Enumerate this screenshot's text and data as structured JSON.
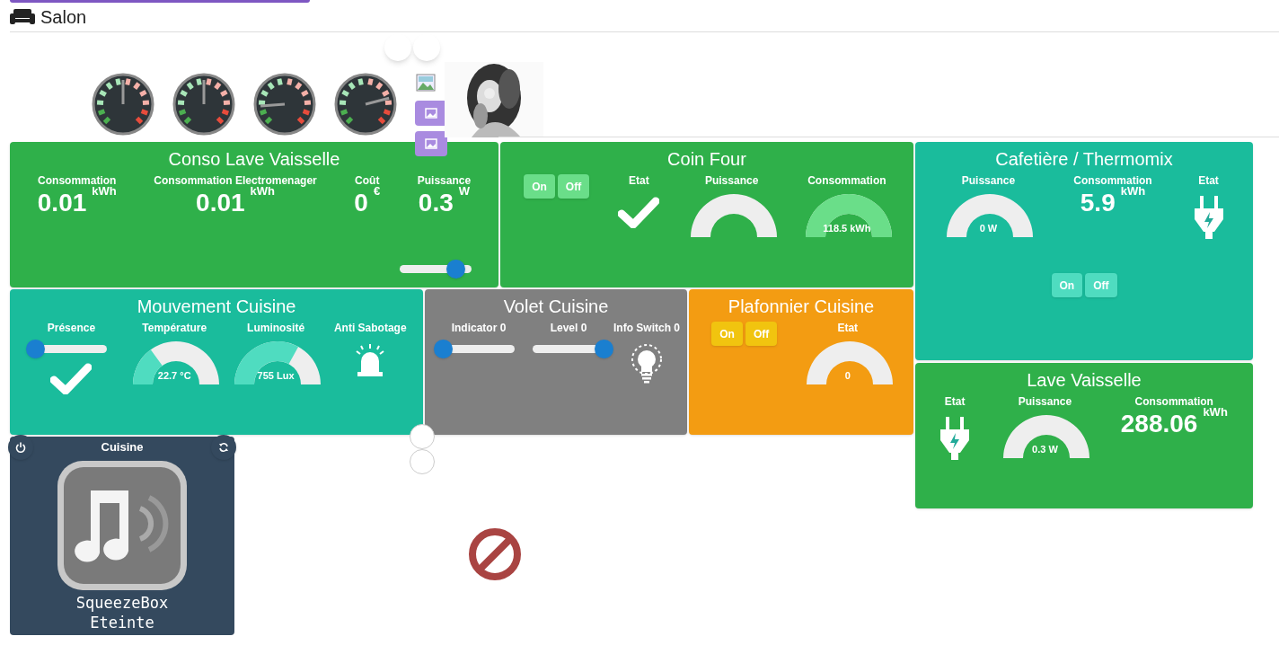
{
  "header": {
    "title": "Salon"
  },
  "tiles": [
    {
      "kind": "tile",
      "title": "Conso Lave Vaisselle",
      "color": "#2fb04a",
      "widgets": [
        {
          "kind": "value",
          "label": "Consommation",
          "value": "0.01",
          "unit": "kWh"
        },
        {
          "kind": "value",
          "label": "Consommation Electromenager",
          "value": "0.01",
          "unit": "kWh"
        },
        {
          "kind": "value",
          "label": "Coût",
          "value": "0",
          "unit": "€"
        },
        {
          "kind": "value",
          "label": "Puissance",
          "value": "0.3",
          "unit": "W"
        }
      ],
      "footer": [
        {
          "kind": "slider",
          "level": 0.78
        }
      ]
    },
    {
      "kind": "tile",
      "title": "Coin Four",
      "color": "#2fb04a",
      "widgets": [
        {
          "kind": "buttons",
          "labels": [
            "On",
            "Off"
          ]
        },
        {
          "kind": "check",
          "label": "Etat"
        },
        {
          "kind": "gauge",
          "label": "Puissance"
        },
        {
          "kind": "gauge",
          "label": "Consommation",
          "level": 1,
          "reading": "118.5 kWh"
        }
      ]
    },
    {
      "kind": "tile",
      "title": "Cafetière / Thermomix",
      "color": "#1abc9c",
      "widgets": [
        {
          "kind": "gauge",
          "label": "Puissance",
          "reading": "0 W"
        },
        {
          "kind": "value",
          "label": "Consommation",
          "value": "5.9",
          "unit": "kWh"
        },
        {
          "kind": "plug",
          "label": "Etat"
        }
      ],
      "footer": [
        {
          "kind": "buttons",
          "labels": [
            "On",
            "Off"
          ]
        }
      ]
    },
    {
      "kind": "tile",
      "title": "Mouvement Cuisine",
      "color": "#1abc9c",
      "widgets": [
        {
          "kind": "presence",
          "label": "Présence",
          "level": 0
        },
        {
          "kind": "gauge",
          "label": "Température",
          "level": 0.3,
          "reading": "22.7 °C"
        },
        {
          "kind": "gauge",
          "label": "Luminosité",
          "level": 0.66,
          "reading": "755 Lux"
        },
        {
          "kind": "siren",
          "label": "Anti Sabotage"
        }
      ]
    },
    {
      "kind": "tile",
      "title": "Volet Cuisine",
      "color": "#808080",
      "widgets": [
        {
          "kind": "slider",
          "label": "Indicator 0",
          "level": 0
        },
        {
          "kind": "slider",
          "label": "Level 0",
          "level": 1
        },
        {
          "kind": "bulb",
          "label": "Info Switch 0"
        }
      ]
    },
    {
      "kind": "tile",
      "title": "Plafonnier Cuisine",
      "color": "#f39c12",
      "widgets": [
        {
          "kind": "buttons",
          "labels": [
            "On",
            "Off"
          ]
        },
        {
          "kind": "gauge",
          "label": "Etat",
          "reading": "0"
        }
      ]
    },
    {
      "kind": "tile",
      "title": "Lave Vaisselle",
      "color": "#2fb04a",
      "widgets": [
        {
          "kind": "plug",
          "label": "Etat"
        },
        {
          "kind": "gauge",
          "label": "Puissance",
          "reading": "0.3 W"
        },
        {
          "kind": "value",
          "label": "Consommation",
          "value": "288.06",
          "unit": "kWh"
        }
      ]
    },
    {
      "kind": "media",
      "title": "Cuisine",
      "lines": [
        "SqueezeBox",
        "Eteinte"
      ]
    }
  ]
}
